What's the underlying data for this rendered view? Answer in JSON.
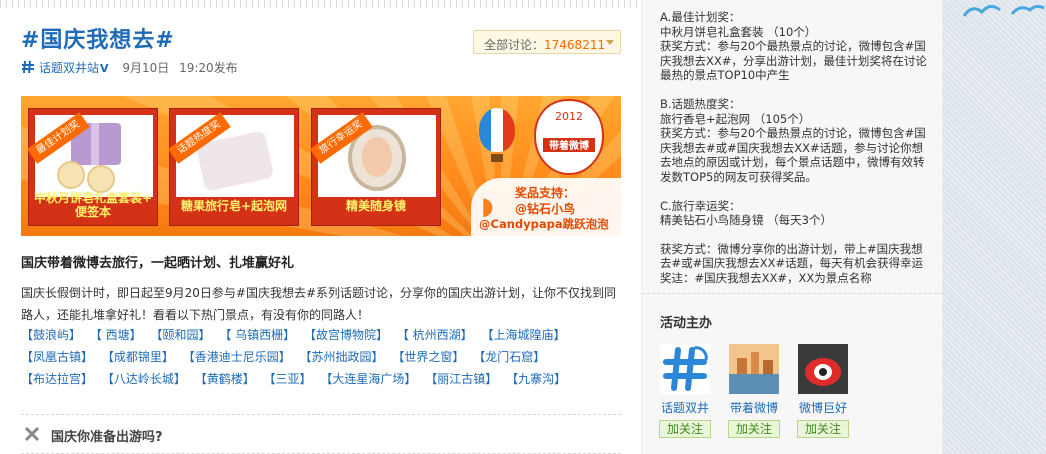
{
  "topic": {
    "title": "#国庆我想去#",
    "total_label": "全部讨论：",
    "total_count": "17468211",
    "author": "话题双井站",
    "v_badge": "V",
    "date": "9月10日",
    "time_published": "19:20发布"
  },
  "banner": {
    "prize1_tag": "最佳计划奖",
    "prize1_caption_1": "中秋月饼皂礼盒套装+",
    "prize1_caption_2": "便签本",
    "prize2_tag": "话题热度奖",
    "prize2_caption": "糖果旅行皂+起泡网",
    "prize3_tag": "旅行幸运奖",
    "prize3_caption": "精美随身镜",
    "badge_year": "2012",
    "badge_text": "带着微博",
    "sponsor_label": "奖品支持：",
    "sponsor_1": "@钻石小鸟",
    "sponsor_2": "@Candypapa跳跃泡泡"
  },
  "intro": {
    "heading": "国庆带着微博去旅行，一起晒计划、扎堆赢好礼",
    "text": "国庆长假倒计时，即日起至9月20日参与#国庆我想去#系列话题讨论，分享你的国庆出游计划，让你不仅找到同路人，还能扎堆拿好礼！看看以下热门景点，有没有你的同路人！"
  },
  "places": [
    "【鼓浪屿】",
    "【 西塘】",
    "【颐和园】",
    "【 乌镇西栅】",
    "【故宫博物院】",
    "【 杭州西湖】",
    "【上海城隍庙】",
    "【凤凰古镇】",
    "【成都锦里】",
    "【香港迪士尼乐园】",
    "【苏州拙政园】",
    "【世界之窗】",
    "【龙门石窟】",
    "【布达拉宫】",
    "【八达岭长城】",
    "【黄鹤楼】",
    "【三亚】",
    "【大连星海广场】",
    "【丽江古镇】",
    "【九寨沟】"
  ],
  "section": {
    "title": "国庆你准备出游吗?"
  },
  "sidebar": {
    "rules": [
      [
        "A.最佳计划奖：",
        "中秋月饼皂礼盒套装 （10个）",
        "获奖方式：参与20个最热景点的讨论，微博包含#国庆我想去XX#，分享出游计划，最佳计划奖将在讨论最热的景点TOP10中产生"
      ],
      [
        "B.话题热度奖：",
        "旅行香皂+起泡网 （105个）",
        "获奖方式：参与20个最热景点的讨论，微博包含#国庆我想去#或#国庆我想去XX#话题，参与讨论你想去地点的原因或计划，每个景点话题中，微博有效转发数TOP5的网友可获得奖品。"
      ],
      [
        "C.旅行幸运奖：",
        "精美钻石小鸟随身镜 （每天3个）",
        "",
        "获奖方式：微博分享你的出游计划，带上#国庆我想去#或#国庆我想去XX#话题，每天有机会获得幸运奖迬：#国庆我想去XX#，XX为景点名称"
      ]
    ],
    "org_title": "活动主办",
    "orgs": [
      {
        "name": "话题双井",
        "follow": "加关注"
      },
      {
        "name": "带着微博",
        "follow": "加关注"
      },
      {
        "name": "微博巨好",
        "follow": "加关注"
      }
    ]
  },
  "colors": {
    "link": "#1e6bb8",
    "count": "#ff6600",
    "banner": "#ff8a1a"
  }
}
